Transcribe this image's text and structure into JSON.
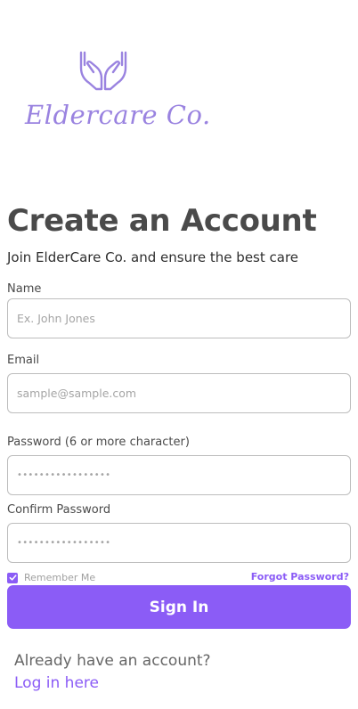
{
  "brand": {
    "logo_icon": "caring-hands-icon",
    "name": "Eldercare Co.",
    "color": "#9a83e0"
  },
  "header": {
    "title": "Create an Account",
    "subtitle": "Join ElderCare Co. and ensure the best care"
  },
  "form": {
    "name": {
      "label": "Name",
      "placeholder": "Ex. John Jones",
      "value": ""
    },
    "email": {
      "label": "Email",
      "placeholder": "sample@sample.com",
      "value": ""
    },
    "password": {
      "label": "Password (6 or more character)",
      "placeholder": "•••••••••••••••••",
      "value": ""
    },
    "confirm_password": {
      "label": "Confirm Password",
      "placeholder": "•••••••••••••••••",
      "value": ""
    },
    "remember_me": {
      "label": "Remember Me",
      "checked": true
    },
    "forgot_password": "Forgot Password?",
    "submit_label": "Sign In"
  },
  "footer": {
    "prompt": "Already have an account?",
    "login_link": "Log in here"
  },
  "colors": {
    "accent": "#8b5cf6",
    "text": "#4a4a4a"
  }
}
